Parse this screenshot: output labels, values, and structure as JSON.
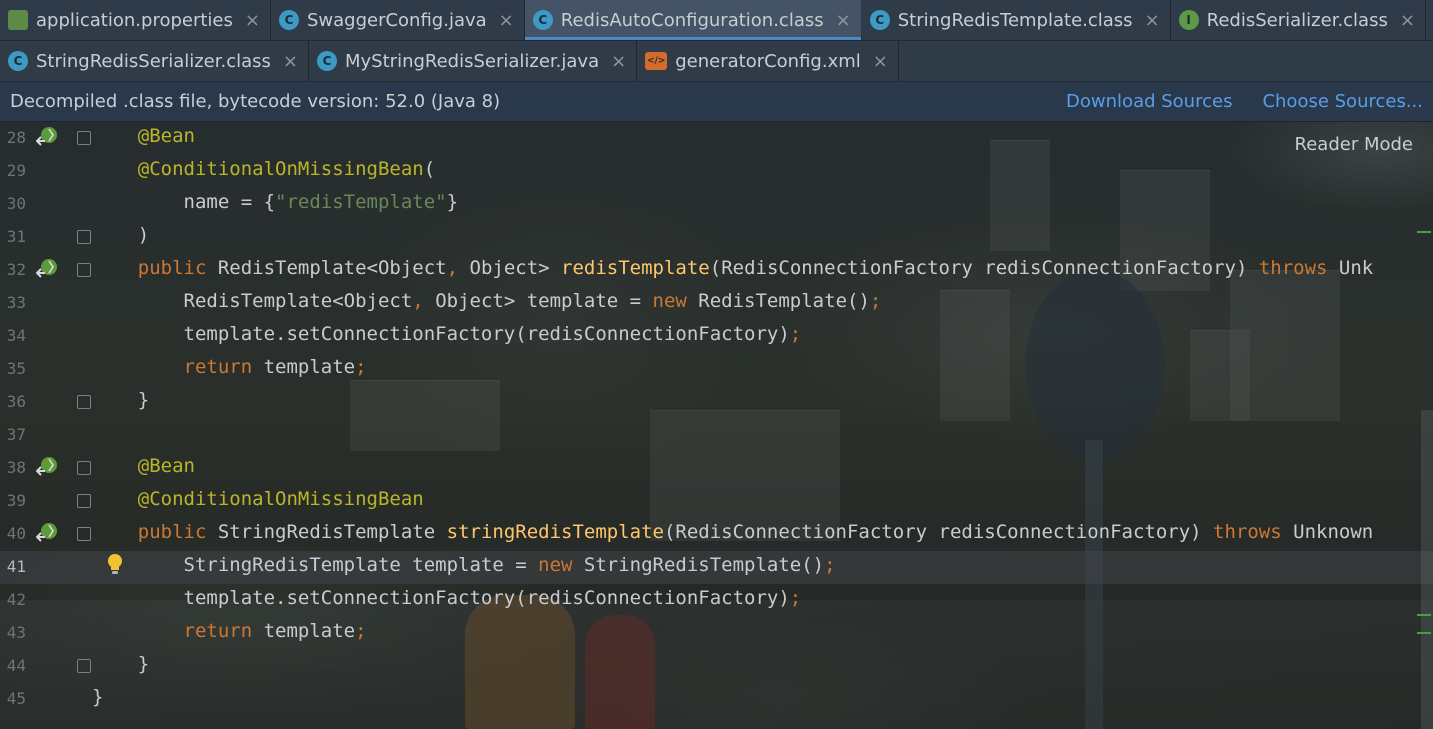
{
  "tabs_row1": [
    {
      "label": "application.properties",
      "icon": "properties-file-icon",
      "active": false
    },
    {
      "label": "SwaggerConfig.java",
      "icon": "class-icon",
      "active": false
    },
    {
      "label": "RedisAutoConfiguration.class",
      "icon": "class-file-icon",
      "active": true
    },
    {
      "label": "StringRedisTemplate.class",
      "icon": "class-file-icon",
      "active": false
    },
    {
      "label": "RedisSerializer.class",
      "icon": "interface-file-icon",
      "active": false
    }
  ],
  "tabs_row2": [
    {
      "label": "StringRedisSerializer.class",
      "icon": "class-file-icon",
      "active": false
    },
    {
      "label": "MyStringRedisSerializer.java",
      "icon": "class-icon",
      "active": false
    },
    {
      "label": "generatorConfig.xml",
      "icon": "xml-file-icon",
      "active": false
    }
  ],
  "banner": {
    "message": "Decompiled .class file, bytecode version: 52.0 (Java 8)",
    "download_sources": "Download Sources",
    "choose_sources": "Choose Sources..."
  },
  "reader_mode": "Reader Mode",
  "caret_line": "41",
  "lines": [
    {
      "num": "28",
      "tokens": [
        [
          "ann",
          "    @Bean"
        ]
      ]
    },
    {
      "num": "29",
      "tokens": [
        [
          "ann",
          "    @ConditionalOnMissingBean"
        ],
        [
          "",
          "("
        ]
      ]
    },
    {
      "num": "30",
      "tokens": [
        [
          "",
          "        name = {"
        ],
        [
          "str",
          "\"redisTemplate\""
        ],
        [
          "",
          "}"
        ]
      ]
    },
    {
      "num": "31",
      "tokens": [
        [
          "",
          "    )"
        ]
      ]
    },
    {
      "num": "32",
      "tokens": [
        [
          "kw",
          "    public "
        ],
        [
          "",
          "RedisTemplate<Object"
        ],
        [
          "kw",
          ", "
        ],
        [
          "",
          "Object> "
        ],
        [
          "fn",
          "redisTemplate"
        ],
        [
          "",
          "(RedisConnectionFactory redisConnectionFactory) "
        ],
        [
          "kw",
          "throws "
        ],
        [
          "",
          "Unk"
        ]
      ]
    },
    {
      "num": "33",
      "tokens": [
        [
          "",
          "        RedisTemplate<Object"
        ],
        [
          "kw",
          ", "
        ],
        [
          "",
          "Object> template = "
        ],
        [
          "kw",
          "new "
        ],
        [
          "",
          "RedisTemplate()"
        ],
        [
          "kw",
          ";"
        ]
      ]
    },
    {
      "num": "34",
      "tokens": [
        [
          "",
          "        template.setConnectionFactory(redisConnectionFactory)"
        ],
        [
          "kw",
          ";"
        ]
      ]
    },
    {
      "num": "35",
      "tokens": [
        [
          "kw",
          "        return "
        ],
        [
          "",
          "template"
        ],
        [
          "kw",
          ";"
        ]
      ]
    },
    {
      "num": "36",
      "tokens": [
        [
          "",
          "    }"
        ]
      ]
    },
    {
      "num": "37",
      "tokens": []
    },
    {
      "num": "38",
      "tokens": [
        [
          "ann",
          "    @Bean"
        ]
      ]
    },
    {
      "num": "39",
      "tokens": [
        [
          "ann",
          "    @ConditionalOnMissingBean"
        ]
      ]
    },
    {
      "num": "40",
      "tokens": [
        [
          "kw",
          "    public "
        ],
        [
          "",
          "StringRedisTemplate "
        ],
        [
          "fn",
          "stringRedisTemplate"
        ],
        [
          "",
          "(RedisConnectionFactory redisConnectionFactory) "
        ],
        [
          "kw",
          "throws "
        ],
        [
          "",
          "Unknown"
        ]
      ]
    },
    {
      "num": "41",
      "tokens": [
        [
          "",
          "        StringRedisTemplate template = "
        ],
        [
          "kw",
          "new "
        ],
        [
          "",
          "StringRedisTemplate()"
        ],
        [
          "kw",
          ";"
        ]
      ]
    },
    {
      "num": "42",
      "tokens": [
        [
          "",
          "        template.setConnectionFactory(redisConnectionFactory)"
        ],
        [
          "kw",
          ";"
        ]
      ]
    },
    {
      "num": "43",
      "tokens": [
        [
          "kw",
          "        return "
        ],
        [
          "",
          "template"
        ],
        [
          "kw",
          ";"
        ]
      ]
    },
    {
      "num": "44",
      "tokens": [
        [
          "",
          "    }"
        ]
      ]
    },
    {
      "num": "45",
      "tokens": [
        [
          "",
          "}"
        ]
      ]
    }
  ],
  "fold_lines": [
    "28",
    "31",
    "32",
    "36",
    "38",
    "39",
    "40",
    "44"
  ],
  "bean_icon_lines": [
    "28",
    "32",
    "38",
    "40"
  ],
  "bulb_line": "41",
  "colors": {
    "keyword": "#cc7832",
    "annotation": "#bbb529",
    "string": "#6a8759",
    "method": "#ffc66d",
    "link": "#5a9ee6",
    "active_tab": "#4a88c7"
  }
}
